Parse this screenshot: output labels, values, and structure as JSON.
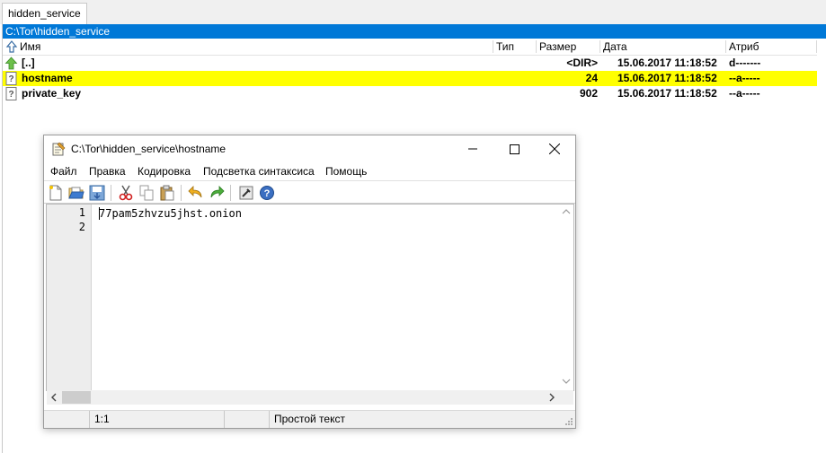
{
  "tab": {
    "label": "hidden_service"
  },
  "panel": {
    "path": "C:\\Tor\\hidden_service",
    "columns": {
      "name": "Имя",
      "type": "Тип",
      "size": "Размер",
      "date": "Дата",
      "attr": "Атриб"
    },
    "files": [
      {
        "name": "[..]",
        "size": "<DIR>",
        "date": "15.06.2017 11:18:52",
        "attr": "d-------",
        "selected": false
      },
      {
        "name": "hostname",
        "size": "24",
        "date": "15.06.2017 11:18:52",
        "attr": "--a-----",
        "selected": true
      },
      {
        "name": "private_key",
        "size": "902",
        "date": "15.06.2017 11:18:52",
        "attr": "--a-----",
        "selected": false
      }
    ],
    "selected_color": "#ffff00",
    "path_bar_color": "#0078d7"
  },
  "editor": {
    "title": "C:\\Tor\\hidden_service\\hostname",
    "menu": [
      "Файл",
      "Правка",
      "Кодировка",
      "Подсветка синтаксиса",
      "Помощь"
    ],
    "lines": [
      {
        "num": "1",
        "text": "77pam5zhvzu5jhst.onion"
      },
      {
        "num": "2",
        "text": ""
      }
    ],
    "status": {
      "position": "1:1",
      "syntax": "Простой текст"
    }
  }
}
